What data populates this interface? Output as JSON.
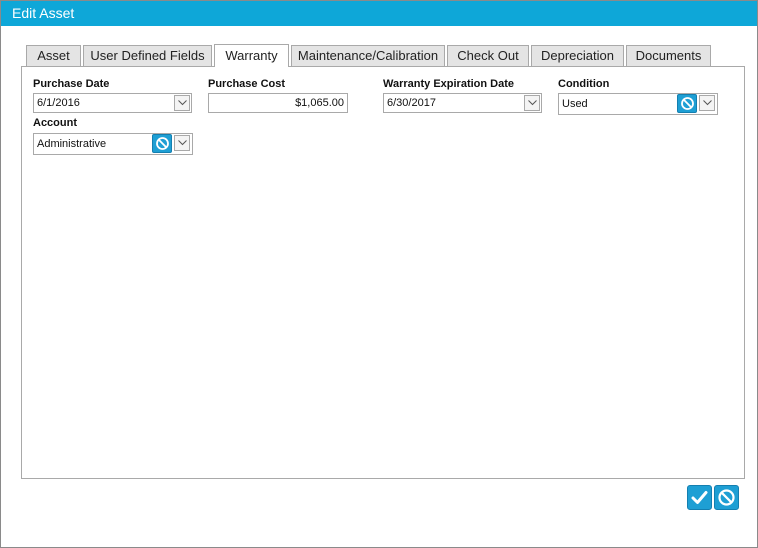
{
  "window": {
    "title": "Edit Asset"
  },
  "tabs": [
    {
      "label": "Asset"
    },
    {
      "label": "User Defined Fields"
    },
    {
      "label": "Warranty"
    },
    {
      "label": "Maintenance/Calibration"
    },
    {
      "label": "Check Out"
    },
    {
      "label": "Depreciation"
    },
    {
      "label": "Documents"
    }
  ],
  "active_tab": "Warranty",
  "form": {
    "purchase_date": {
      "label": "Purchase Date",
      "value": "6/1/2016"
    },
    "purchase_cost": {
      "label": "Purchase Cost",
      "value": "$1,065.00"
    },
    "warranty_expiration": {
      "label": "Warranty Expiration Date",
      "value": "6/30/2017"
    },
    "condition": {
      "label": "Condition",
      "value": "Used"
    },
    "account": {
      "label": "Account",
      "value": "Administrative"
    }
  },
  "icons": {
    "dropdown": "chevron-down-icon",
    "clear": "ban-icon",
    "confirm": "check-icon",
    "cancel": "ban-icon"
  },
  "colors": {
    "accent": "#0ea7d8",
    "button": "#1e9fd4"
  }
}
